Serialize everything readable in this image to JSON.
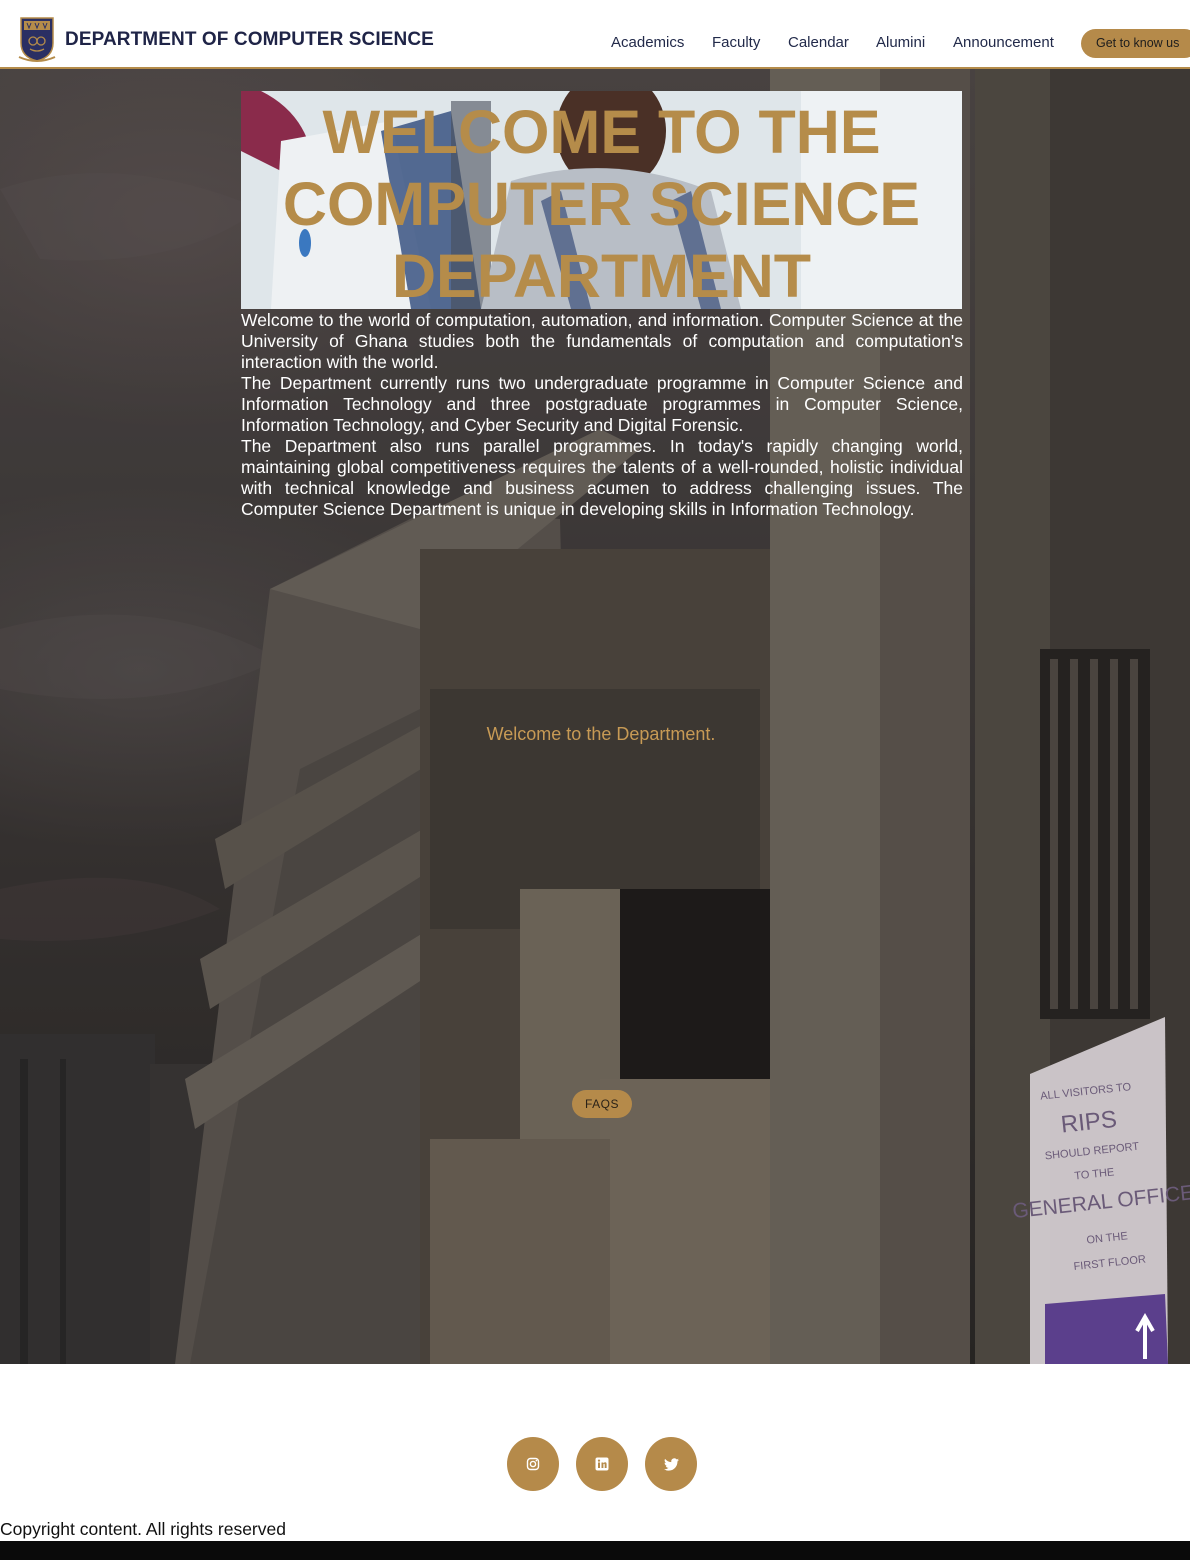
{
  "header": {
    "title": "DEPARTMENT OF COMPUTER SCIENCE",
    "logo_icon": "university-crest-icon",
    "nav": [
      {
        "label": "Academics"
      },
      {
        "label": "Faculty"
      },
      {
        "label": "Calendar"
      },
      {
        "label": "Alumini"
      },
      {
        "label": "Announcement"
      }
    ],
    "cta_label": "Get to know us"
  },
  "hero": {
    "heading": "WELCOME TO THE COMPUTER SCIENCE DEPARTMENT",
    "paragraphs": [
      "Welcome to the world of computation, automation, and information. Computer Science at the University of Ghana studies both the fundamentals of computation and computation's interaction with the world.",
      "The Department currently runs two undergraduate programme in Computer Science and Information Technology and three postgraduate programmes in Computer Science, Information Technology, and Cyber Security and Digital Forensic.",
      "The Department also runs parallel programmes. In today's rapidly changing world, maintaining global competitiveness requires the talents of a well-rounded, holistic individual with technical knowledge and business acumen to address challenging issues. The Computer Science Department is unique in developing skills in Information Technology."
    ],
    "tagline": "Welcome to the Department.",
    "faq_label": "FAQS",
    "sign_text": [
      "ALL VISITORS TO",
      "RIPS",
      "SHOULD REPORT",
      "TO THE",
      "GENERAL OFFICE",
      "ON THE",
      "FIRST FLOOR"
    ]
  },
  "footer": {
    "social": [
      {
        "icon": "instagram-icon"
      },
      {
        "icon": "linkedin-icon"
      },
      {
        "icon": "twitter-icon"
      }
    ],
    "copyright": "Copyright content. All rights reserved"
  },
  "colors": {
    "accent": "#b58a4a",
    "brand_navy": "#1f2447",
    "hero_text": "#ffffff"
  }
}
